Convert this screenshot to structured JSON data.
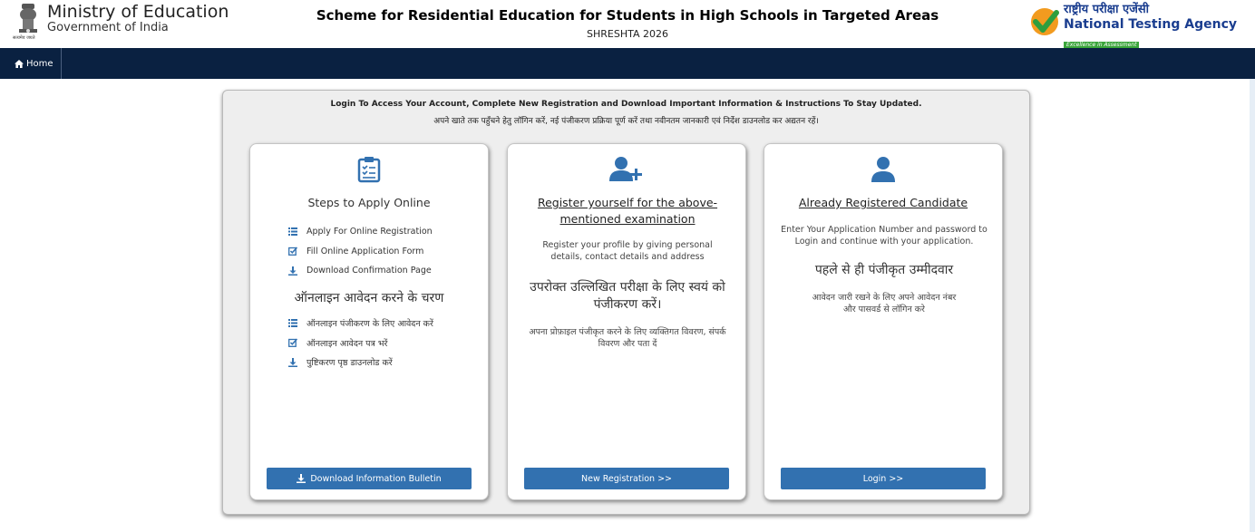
{
  "header": {
    "ministry_title": "Ministry of Education",
    "ministry_sub": "Government of India",
    "emblem_motto": "सत्यमेव जयते",
    "scheme_title": "Scheme for Residential Education for Students in High Schools in Targeted Areas",
    "scheme_sub": "SHRESHTA 2026",
    "nta_hindi": "राष्ट्रीय परीक्षा एजेंसी",
    "nta_english": "National Testing Agency",
    "nta_tagline": "Excellence in Assessment"
  },
  "nav": {
    "home_label": "Home"
  },
  "panel": {
    "heading_en": "Login To Access Your Account, Complete New Registration and Download Important Information & Instructions To Stay Updated.",
    "heading_hi": "अपने खाते तक पहुँचने हेतु लॉगिन करें, नई पंजीकरण प्रक्रिया पूर्ण करें तथा नवीनतम जानकारी एवं निर्देश डाउनलोड कर अद्यतन रहें।"
  },
  "card_steps": {
    "title": "Steps to Apply Online",
    "steps_en": [
      "Apply For Online Registration",
      "Fill Online Application Form",
      "Download Confirmation Page"
    ],
    "title_hi": "ऑनलाइन आवेदन करने के चरण",
    "steps_hi": [
      "ऑनलाइन पंजीकरण के लिए आवेदन करें",
      "ऑनलाइन आवेदन पत्र भरें",
      "पुष्टिकरण पृष्ठ डाउनलोड करें"
    ],
    "button": "Download Information Bulletin"
  },
  "card_register": {
    "title": "Register yourself for the above-mentioned examination",
    "desc_en": "Register your profile by giving personal details, contact details and address",
    "title_hi": "उपरोक्त उल्लिखित परीक्षा के लिए स्वयं को पंजीकरण करें।",
    "desc_hi": "अपना प्रोफ़ाइल पंजीकृत करने के लिए व्यक्तिगत विवरण, संपर्क विवरण और पता दें",
    "button": "New Registration >>"
  },
  "card_login": {
    "title": "Already Registered Candidate",
    "desc_en": "Enter Your Application Number and password to Login and continue with your application.",
    "title_hi": "पहले से ही पंजीकृत उम्मीदवार",
    "desc_hi": "आवेदन जारी रखने के लिए अपने आवेदन नंबर और पासवर्ड से लॉगिन करे",
    "button": "Login >>"
  },
  "colors": {
    "navbar": "#0a2141",
    "button": "#3271b0",
    "icon": "#3271b0",
    "nta_blue": "#1a3d8f"
  },
  "icons": {
    "steps": "checklist-icon",
    "register": "add-user-icon",
    "login": "user-icon"
  }
}
